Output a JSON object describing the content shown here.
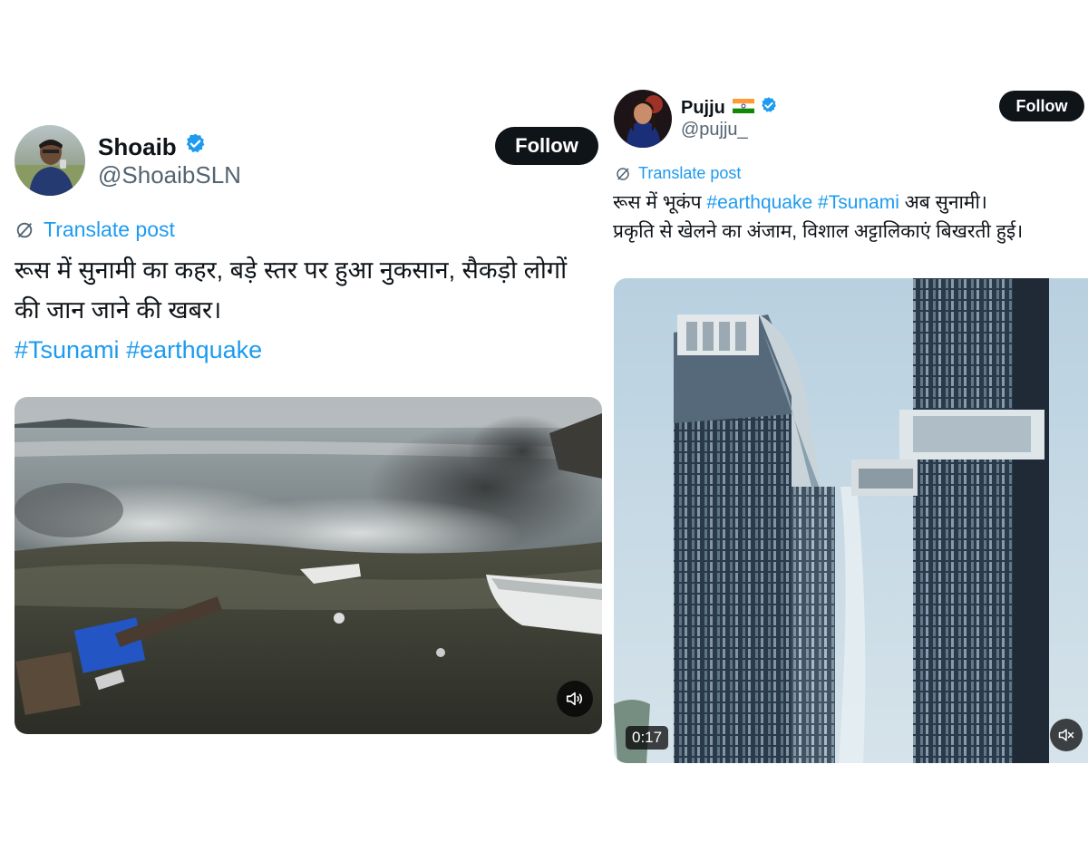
{
  "posts": [
    {
      "author_name": "Shoaib",
      "handle": "@ShoaibSLN",
      "follow_label": "Follow",
      "translate_label": "Translate post",
      "text_line1": "रूस में सुनामी का कहर, बड़े स्तर पर हुआ नुकसान, सैकड़ो लोगों",
      "text_line2": "की जान जाने की खबर।",
      "hashtags": [
        "#Tsunami",
        "#earthquake"
      ],
      "media_icon": "speaker-icon"
    },
    {
      "author_name": "Pujju",
      "flag": "🇮🇳",
      "handle": "@pujju_",
      "follow_label": "Follow",
      "translate_label": "Translate post",
      "text_line1_prefix": "रूस में भूकंप",
      "hashtags": [
        "#earthquake",
        "#Tsunami"
      ],
      "text_line1_suffix": "अब सुनामी।",
      "text_line2": "प्रकृति से खेलने का अंजाम, विशाल अट्टालिकाएं बिखरती  हुई।",
      "video_time": "0:17",
      "media_icon": "muted-speaker-icon"
    }
  ],
  "colors": {
    "link": "#1d9bf0",
    "verified": "#1d9bf0",
    "follow_bg": "#0f1419",
    "secondary_text": "#536471"
  }
}
